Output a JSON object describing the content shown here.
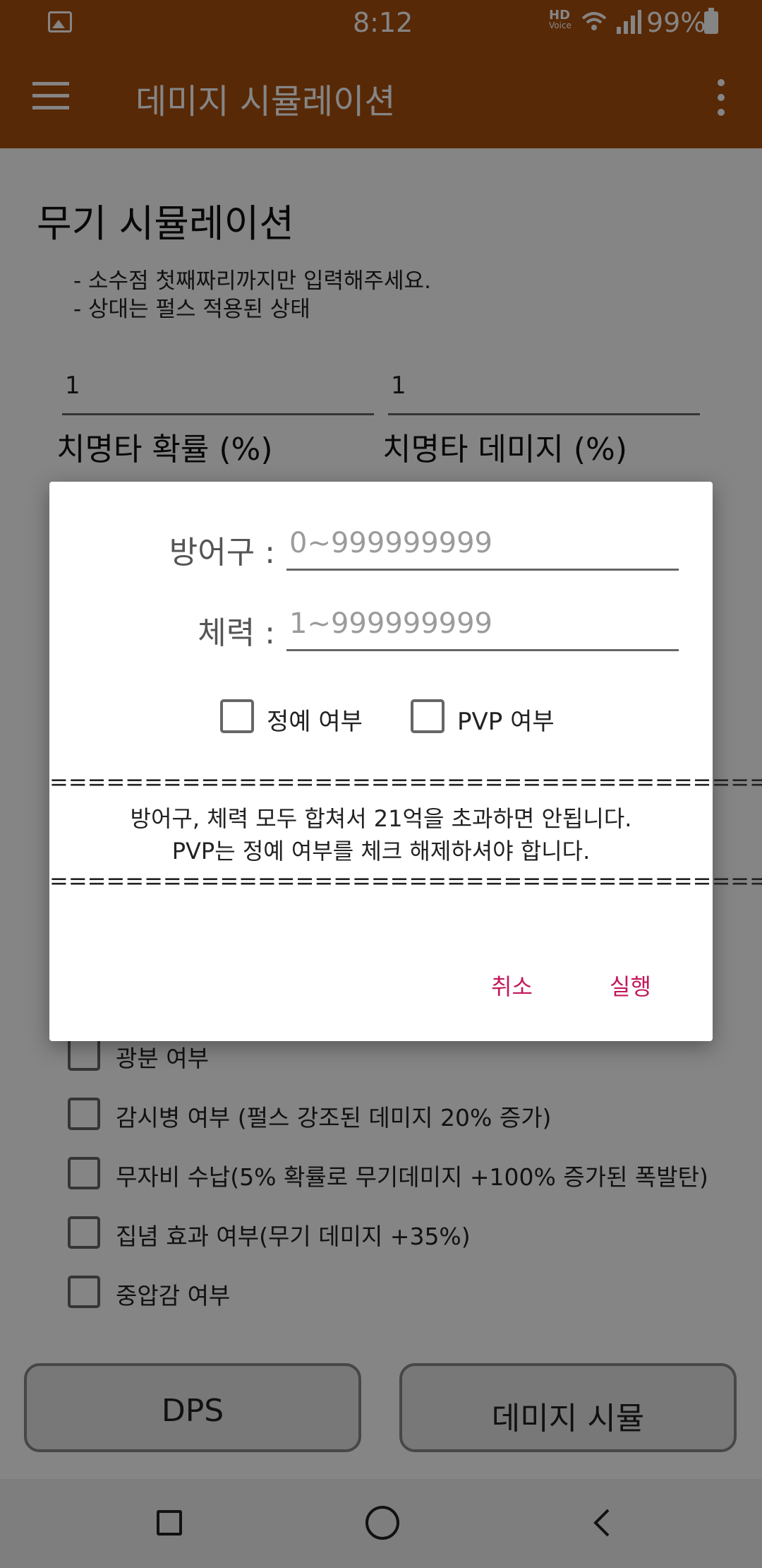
{
  "status_bar": {
    "time": "8:12",
    "hd_label": "HD",
    "voice_label": "Voice",
    "battery": "99%",
    "icons": [
      "gallery-icon",
      "wifi-icon",
      "signal-icon",
      "battery-icon"
    ]
  },
  "app_bar": {
    "title": "데미지 시뮬레이션",
    "color": "#a9500f"
  },
  "page": {
    "section_title": "무기 시뮬레이션",
    "notes": [
      "- 소수점 첫째짜리까지만 입력해주세요.",
      "- 상대는 펄스 적용된 상태"
    ],
    "fields": [
      {
        "value": "1",
        "label": "치명타 확률 (%)"
      },
      {
        "value": "1",
        "label": "치명타 데미지 (%)"
      }
    ],
    "checkboxes": [
      {
        "label": "광분 여부",
        "checked": false
      },
      {
        "label": "감시병 여부 (펄스 강조된 데미지 20% 증가)",
        "checked": false
      },
      {
        "label": "무자비 수납(5% 확률로 무기데미지 +100% 증가된 폭발탄)",
        "checked": false
      },
      {
        "label": "집념 효과 여부(무기 데미지 +35%)",
        "checked": false
      },
      {
        "label": "중압감 여부",
        "checked": false
      }
    ],
    "buttons": {
      "dps": "DPS",
      "damage_sim": "데미지 시뮬"
    }
  },
  "dialog": {
    "armor_label": "방어구 :",
    "armor_placeholder": "0~999999999",
    "health_label": "체력 :",
    "health_placeholder": "1~999999999",
    "elite_checkbox": {
      "label": "정예 여부",
      "checked": false
    },
    "pvp_checkbox": {
      "label": "PVP 여부",
      "checked": false
    },
    "separator": "=======================================",
    "message_1": "방어구, 체력 모두 합쳐서 21억을 초과하면 안됩니다.",
    "message_2": "PVP는 정예 여부를 체크 해제하셔야 합니다.",
    "cancel_label": "취소",
    "run_label": "실행",
    "button_color": "#c2185b"
  }
}
